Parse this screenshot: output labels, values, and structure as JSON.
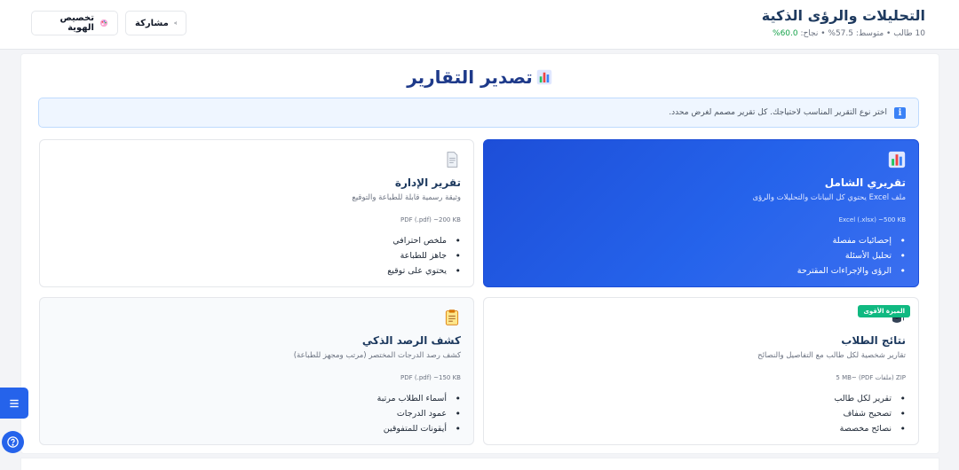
{
  "header": {
    "title": "التحليلات والرؤى الذكية",
    "stats_prefix": "10 طالب • متوسط: 57.5% • نجاح: ",
    "stats_success": "60.0%",
    "share_label": "مشاركة",
    "brand_label": "تخصيص الهوية"
  },
  "main": {
    "title": "تصدير التقارير",
    "info_text": "اختر نوع التقرير المناسب لاحتياجك. كل تقرير مصمم لغرض محدد."
  },
  "cards": [
    {
      "title": "تقريري الشامل",
      "desc": "ملف Excel يحتوي كل البيانات والتحليلات والرؤى",
      "meta": "Excel (.xlsx) ~500 KB",
      "items": [
        "إحصائيات مفصلة",
        "تحليل الأسئلة",
        "الرؤى والإجراءات المقترحة"
      ]
    },
    {
      "title": "تقرير الإدارة",
      "desc": "وثيقة رسمية قابلة للطباعة والتوقيع",
      "meta": "PDF (.pdf) ~200 KB",
      "items": [
        "ملخص احترافي",
        "جاهز للطباعة",
        "يحتوي على توقيع"
      ]
    },
    {
      "title": "نتائج الطلاب",
      "desc": "تقارير شخصية لكل طالب مع التفاصيل والنصائح",
      "meta": "ZIP (ملفات PDF) ~5 MB",
      "badge": "الميزة الأقوى",
      "items": [
        "تقرير لكل طالب",
        "تصحيح شفاف",
        "نصائح مخصصة"
      ]
    },
    {
      "title": "كشف الرصد الذكي",
      "desc": "كشف رصد الدرجات المختصر (مرتب ومجهز للطباعة)",
      "meta": "PDF (.pdf) ~150 KB",
      "items": [
        "أسماء الطلاب مرتبة",
        "عمود الدرجات",
        "أيقونات للمتفوقين"
      ]
    }
  ],
  "colors": {
    "primary": "#2563eb",
    "title": "#1e3a5f",
    "success": "#16a34a",
    "badge": "#10b981"
  },
  "icons": {
    "share": "share-icon",
    "brand": "palette-icon",
    "chart": "bar-chart-icon",
    "document": "document-icon",
    "graduation": "graduation-cap-icon",
    "clipboard": "clipboard-icon",
    "menu": "menu-icon",
    "help": "help-icon"
  }
}
